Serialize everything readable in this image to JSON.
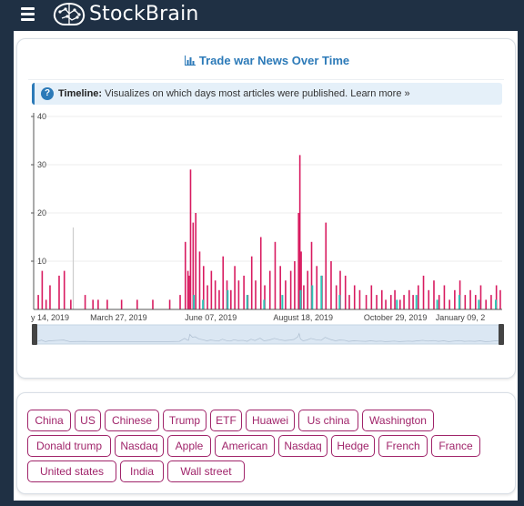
{
  "app": {
    "name": "StockBrain",
    "icons": {
      "menu": "hamburger-icon",
      "logo": "brain-logo-icon"
    }
  },
  "chart_panel": {
    "title": "Trade war News Over Time",
    "title_icon": "bar-chart-icon",
    "info": {
      "label": "Timeline:",
      "text": "Visualizes on which days most articles were published.",
      "link": "Learn more »",
      "icon": "question-circle-icon"
    }
  },
  "chart_data": {
    "type": "bar",
    "title": "Trade war News Over Time",
    "xlabel": "",
    "ylabel": "",
    "ylim": [
      0,
      40
    ],
    "yticks": [
      "10",
      "20",
      "30",
      "40"
    ],
    "xticks": [
      "y 14, 2019",
      "March 27, 2019",
      "June 07, 2019",
      "August 18, 2019",
      "October 29, 2019",
      "January 09, 2"
    ],
    "x_range": [
      "2019-01-14",
      "2020-01-09"
    ],
    "grid": true,
    "colors": {
      "primary": "#d81b60",
      "secondary": "#2ec4b6",
      "highlight": "#cccccc"
    },
    "series": [
      {
        "x": [
          "2019-01-17",
          "2019-01-20",
          "2019-01-23",
          "2019-01-26",
          "2019-02-02",
          "2019-02-06",
          "2019-02-11",
          "2019-02-22",
          "2019-02-28",
          "2019-03-04",
          "2019-03-11",
          "2019-03-22",
          "2019-04-03",
          "2019-04-15",
          "2019-04-28",
          "2019-05-06",
          "2019-05-10",
          "2019-05-12",
          "2019-05-13",
          "2019-05-14",
          "2019-05-16",
          "2019-05-18",
          "2019-05-21",
          "2019-05-24",
          "2019-05-27",
          "2019-05-30",
          "2019-06-02",
          "2019-06-05",
          "2019-06-08",
          "2019-06-11",
          "2019-06-14",
          "2019-06-17",
          "2019-06-20",
          "2019-06-24",
          "2019-06-27",
          "2019-06-30",
          "2019-07-03",
          "2019-07-07",
          "2019-07-10",
          "2019-07-14",
          "2019-07-18",
          "2019-07-22",
          "2019-07-26",
          "2019-07-30",
          "2019-08-02",
          "2019-08-05",
          "2019-08-06",
          "2019-08-07",
          "2019-08-09",
          "2019-08-12",
          "2019-08-15",
          "2019-08-19",
          "2019-08-23",
          "2019-08-26",
          "2019-08-30",
          "2019-09-03",
          "2019-09-06",
          "2019-09-10",
          "2019-09-13",
          "2019-09-17",
          "2019-09-21",
          "2019-09-26",
          "2019-09-30",
          "2019-10-04",
          "2019-10-08",
          "2019-10-11",
          "2019-10-15",
          "2019-10-18",
          "2019-10-22",
          "2019-10-25",
          "2019-10-29",
          "2019-11-01",
          "2019-11-05",
          "2019-11-09",
          "2019-11-13",
          "2019-11-17",
          "2019-11-21",
          "2019-11-25",
          "2019-11-29",
          "2019-12-03",
          "2019-12-07",
          "2019-12-11",
          "2019-12-15",
          "2019-12-19",
          "2019-12-23",
          "2019-12-27",
          "2019-12-31",
          "2020-01-04",
          "2020-01-07"
        ],
        "values": [
          3,
          8,
          2,
          5,
          7,
          8,
          2,
          3,
          2,
          2,
          2,
          2,
          2,
          2,
          2,
          3,
          14,
          8,
          7,
          29,
          18,
          20,
          12,
          9,
          5,
          8,
          6,
          4,
          11,
          6,
          4,
          9,
          6,
          7,
          3,
          11,
          6,
          15,
          5,
          8,
          14,
          9,
          6,
          8,
          10,
          20,
          32,
          12,
          5,
          8,
          14,
          9,
          7,
          18,
          10,
          5,
          8,
          7,
          3,
          5,
          4,
          3,
          5,
          3,
          4,
          2,
          3,
          4,
          2,
          3,
          4,
          3,
          5,
          7,
          4,
          6,
          3,
          5,
          2,
          4,
          6,
          3,
          4,
          3,
          5,
          2,
          3,
          5,
          4
        ]
      },
      {
        "x": [
          "2019-05-15",
          "2019-05-22",
          "2019-06-10",
          "2019-06-25",
          "2019-07-08",
          "2019-07-22",
          "2019-08-05",
          "2019-08-14",
          "2019-08-21",
          "2019-09-04",
          "2019-10-18",
          "2019-11-02",
          "2019-11-18",
          "2019-12-05",
          "2019-12-20",
          "2020-01-02"
        ],
        "values": [
          3,
          2,
          4,
          3,
          2,
          3,
          4,
          5,
          7,
          3,
          2,
          3,
          2,
          3,
          2,
          2
        ]
      }
    ],
    "highlight": {
      "x": "2019-02-13",
      "value": 17
    }
  },
  "tags": [
    "China",
    "US",
    "Chinese",
    "Trump",
    "ETF",
    "Huawei",
    "Us china",
    "Washington",
    "Donald trump",
    "Nasdaq",
    "Apple",
    "American",
    "Nasdaq",
    "Hedge",
    "French",
    "France",
    "United states",
    "India",
    "Wall street"
  ]
}
